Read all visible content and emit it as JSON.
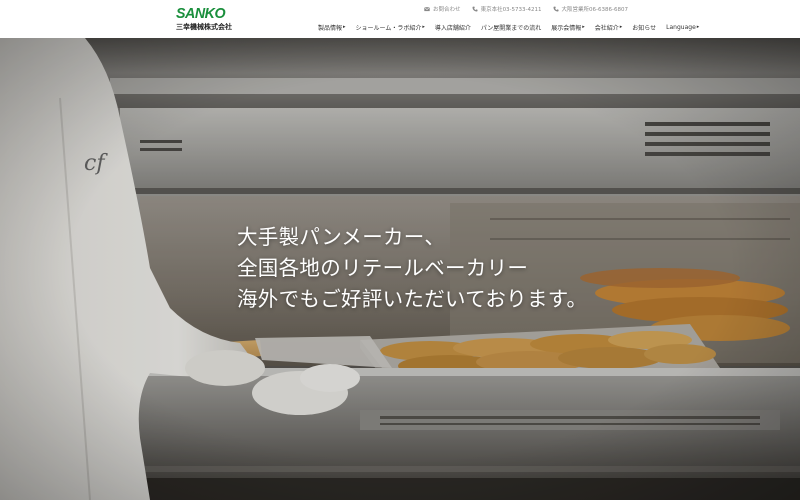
{
  "brand": {
    "logo_word": "SANKO",
    "logo_sub": "三幸機械株式会社",
    "logo_color": "#1a8f3c"
  },
  "contact": [
    {
      "icon": "mail-icon",
      "label": "お問合わせ"
    },
    {
      "icon": "phone-icon",
      "label": "東京本社03-5733-4211"
    },
    {
      "icon": "phone-icon",
      "label": "大阪営業所06-6386-6807"
    }
  ],
  "nav": [
    {
      "label": "製品情報",
      "has_chevron": true
    },
    {
      "label": "ショールーム・ラボ紹介",
      "has_chevron": true
    },
    {
      "label": "導入店舗紹介",
      "has_chevron": false
    },
    {
      "label": "パン屋開業までの流れ",
      "has_chevron": false
    },
    {
      "label": "展示会情報",
      "has_chevron": true
    },
    {
      "label": "会社紹介",
      "has_chevron": true
    },
    {
      "label": "お知らせ",
      "has_chevron": false
    },
    {
      "label": "Language",
      "has_chevron": true
    }
  ],
  "hero": {
    "lines": [
      "大手製パンメーカー、",
      "全国各地のリテールベーカリー",
      "海外でもご好評いただいております。"
    ]
  }
}
